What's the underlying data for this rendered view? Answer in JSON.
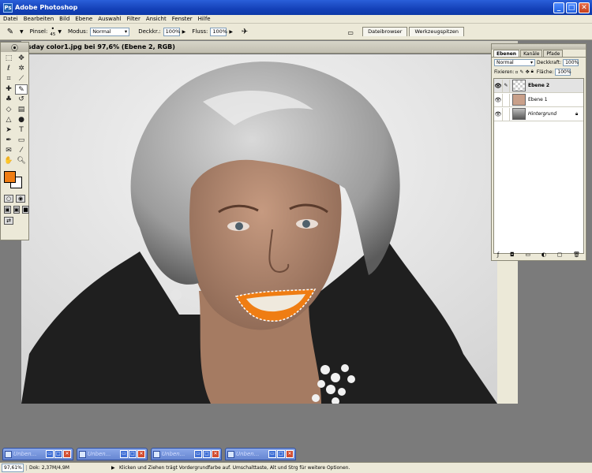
{
  "window": {
    "title": "Adobe Photoshop",
    "app_icon": "Ps"
  },
  "menu": [
    "Datei",
    "Bearbeiten",
    "Bild",
    "Ebene",
    "Auswahl",
    "Filter",
    "Ansicht",
    "Fenster",
    "Hilfe"
  ],
  "options": {
    "brush_label": "Pinsel:",
    "brush_size": "45",
    "mode_label": "Modus:",
    "mode_value": "Normal",
    "opacity_label": "Deckkr.:",
    "opacity_value": "100%",
    "flow_label": "Fluss:",
    "flow_value": "100%"
  },
  "palette_well": {
    "tabs": [
      "Dateibrowser",
      "Werkzeugspitzen"
    ]
  },
  "document": {
    "title": "sday color1.jpg bei 97,6% (Ebene 2, RGB)"
  },
  "toolbox": {
    "foreground_color": "#ef7d13",
    "background_color": "#ffffff"
  },
  "layers_panel": {
    "tabs": [
      "Ebenen",
      "Kanäle",
      "Pfade"
    ],
    "blend_mode": "Normal",
    "opacity_label": "Deckkraft:",
    "opacity_value": "100%",
    "lock_label": "Fixieren:",
    "fill_label": "Fläche:",
    "fill_value": "100%",
    "layers": [
      {
        "name": "Ebene 2",
        "active": true
      },
      {
        "name": "Ebene 1",
        "active": false
      },
      {
        "name": "Hintergrund",
        "active": false,
        "locked": true
      }
    ]
  },
  "minimized_docs": [
    "Unben...",
    "Unben...",
    "Unben...",
    "Unben..."
  ],
  "statusbar": {
    "zoom": "97,61%",
    "doc_info": "Dok: 2,37M/4,9M",
    "hint": "Klicken und Ziehen trägt Vordergrundfarbe auf. Umschalttaste, Alt und Strg für weitere Optionen."
  }
}
